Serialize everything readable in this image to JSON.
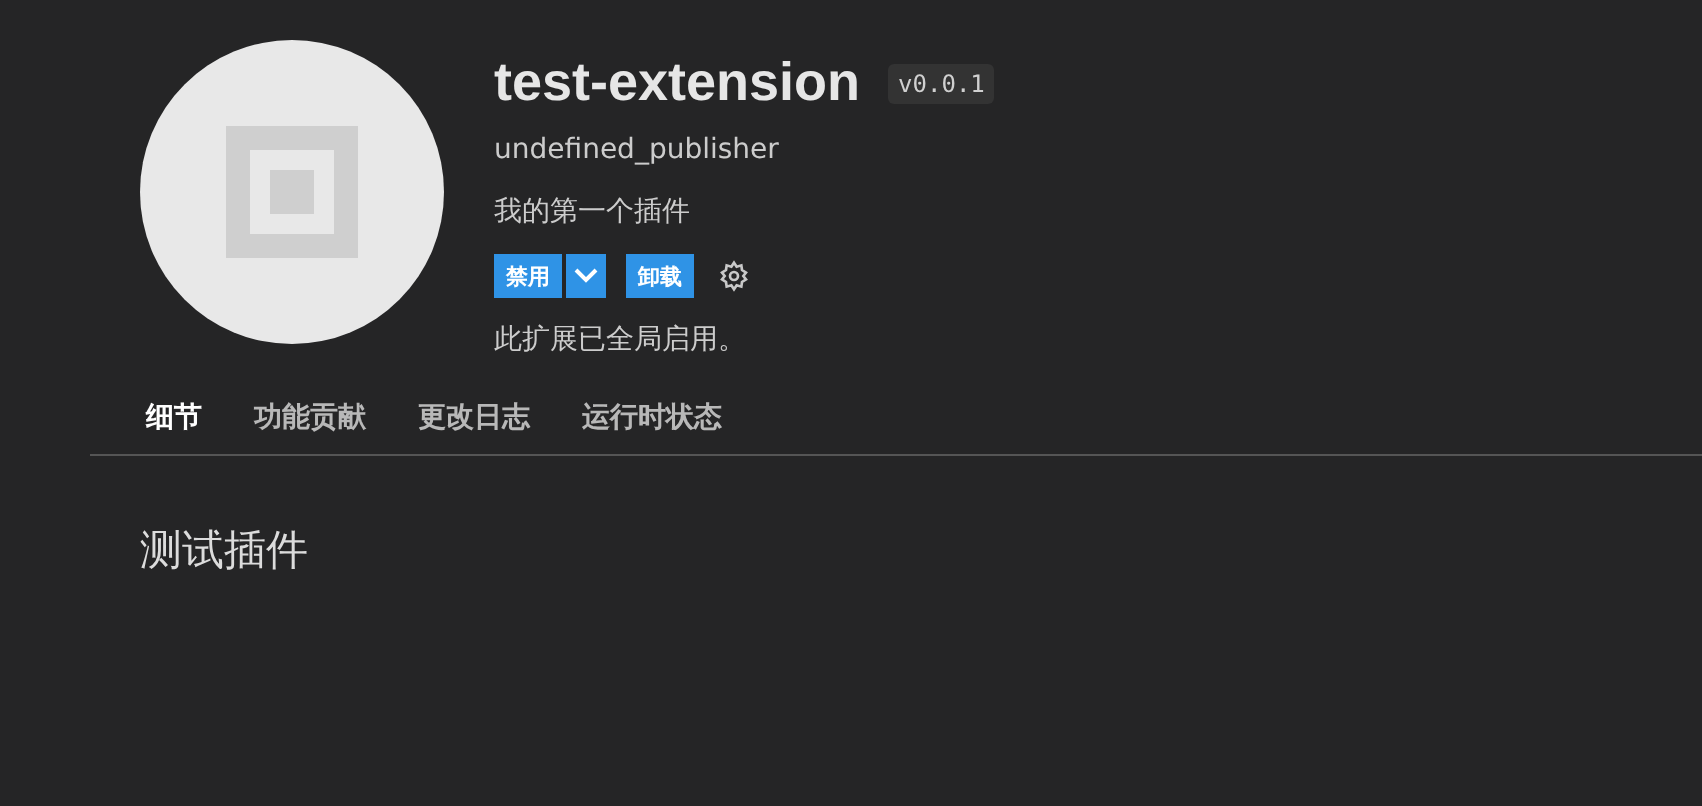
{
  "extension": {
    "name": "test-extension",
    "version": "v0.0.1",
    "publisher": "undefined_publisher",
    "description": "我的第一个插件",
    "status": "此扩展已全局启用。"
  },
  "actions": [
    {
      "kind": "primary",
      "label": "禁用"
    },
    {
      "kind": "dropdown"
    },
    {
      "kind": "primary",
      "label": "卸载"
    },
    {
      "kind": "settings"
    }
  ],
  "tabs": [
    {
      "label": "细节",
      "selected": true
    },
    {
      "label": "功能贡献",
      "selected": false
    },
    {
      "label": "更改日志",
      "selected": false
    },
    {
      "label": "运行时状态",
      "selected": false
    }
  ],
  "readme": {
    "heading": "测试插件"
  }
}
